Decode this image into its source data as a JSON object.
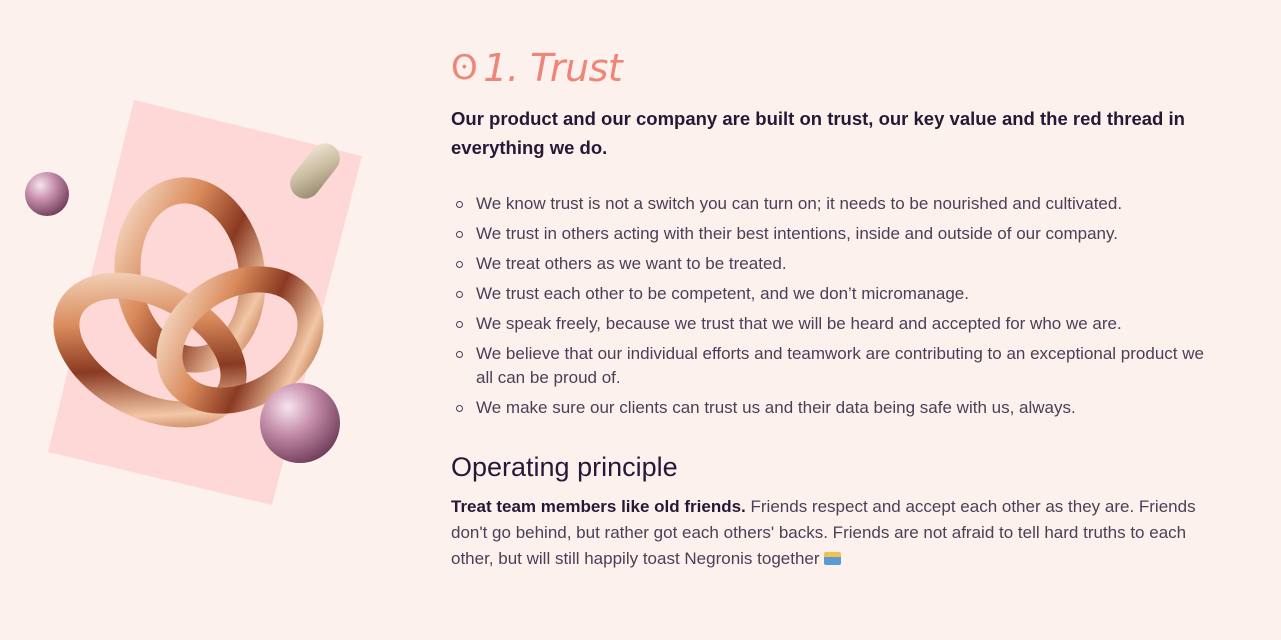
{
  "section": {
    "number_icon": "ʘ",
    "title": "1. Trust",
    "lead": "Our product and our company are built on trust, our key value and the red thread in everything we do."
  },
  "values": [
    "We know trust is not a switch you can turn on; it needs to be nourished and cultivated.",
    "We trust in others acting with their best intentions, inside and outside of our company.",
    "We treat others as we want to be treated.",
    "We trust each other to be competent, and we don’t micromanage.",
    "We speak freely, because we trust that we will be heard and accepted for who we are.",
    "We believe that our individual efforts and teamwork are contributing to an exceptional product we all can be proud of.",
    "We make sure our clients can trust us and their data being safe with us, always."
  ],
  "principle": {
    "heading": "Operating principle",
    "bold": "Treat team members like old friends.",
    "text": " Friends respect and accept each other as they are. Friends don't go behind, but rather got each others' backs. Friends are not afraid to tell hard truths to each other, but will still happily toast Negronis together",
    "emoji_icon": "sunset-picture-icon"
  },
  "colors": {
    "background": "#fcf1ec",
    "accent": "#f08577",
    "heading": "#2a1737",
    "body": "#4d3e57",
    "card": "#fdd8d6"
  }
}
